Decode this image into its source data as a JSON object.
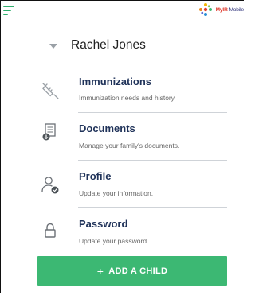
{
  "header": {
    "menu_icon": "hamburger-menu-icon",
    "logo_text_brand": "MyIR",
    "logo_text_rest": " Mobile"
  },
  "profile": {
    "name": "Rachel Jones",
    "expand_icon": "caret-down-icon"
  },
  "menu": {
    "items": [
      {
        "title": "Immunizations",
        "description": "Immunization needs and history.",
        "icon": "syringe-icon"
      },
      {
        "title": "Documents",
        "description": "Manage your family's documents.",
        "icon": "document-download-icon"
      },
      {
        "title": "Profile",
        "description": "Update your information.",
        "icon": "user-edit-icon"
      },
      {
        "title": "Password",
        "description": "Update your password.",
        "icon": "lock-icon"
      }
    ]
  },
  "actions": {
    "add_child_label": "ADD A CHILD",
    "add_child_icon": "plus-icon",
    "plus_glyph": "+"
  },
  "colors": {
    "accent_green": "#3cb873",
    "title_navy": "#1f3259",
    "menu_green": "#2fae6d"
  }
}
